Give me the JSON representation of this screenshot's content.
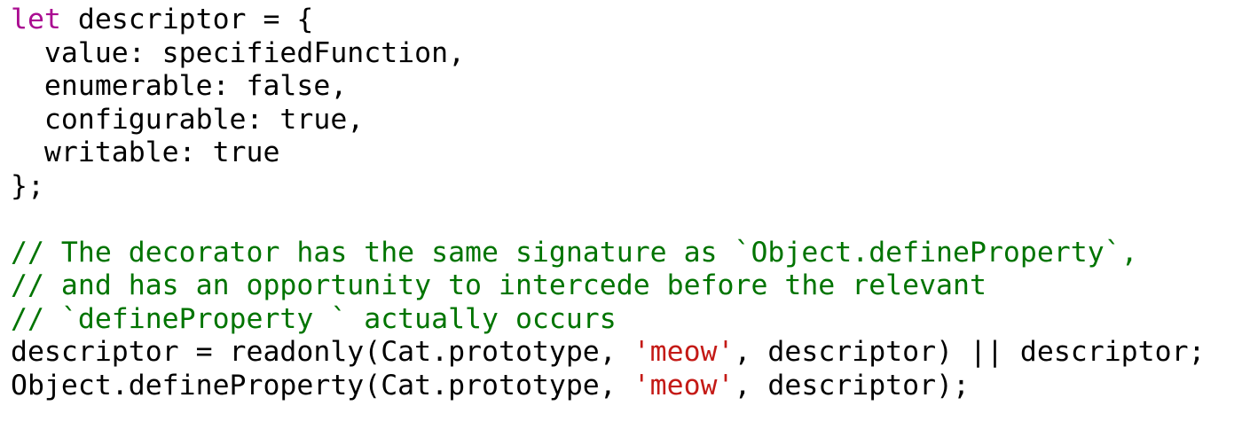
{
  "colors": {
    "keyword": "#aa0d91",
    "comment": "#007400",
    "string": "#c41a16",
    "plain": "#000000",
    "background": "#ffffff"
  },
  "code": {
    "lines": [
      {
        "keyword": "let",
        "rest": " descriptor = {"
      },
      {
        "text": "  value: specifiedFunction,"
      },
      {
        "text": "  enumerable: false,"
      },
      {
        "text": "  configurable: true,"
      },
      {
        "text": "  writable: true"
      },
      {
        "text": "};"
      },
      {
        "text": ""
      },
      {
        "comment": "// The decorator has the same signature as `Object.defineProperty`,"
      },
      {
        "comment": "// and has an opportunity to intercede before the relevant"
      },
      {
        "comment": "// `defineProperty ` actually occurs"
      },
      {
        "before": "descriptor = readonly(Cat.prototype, ",
        "string": "'meow'",
        "after": ", descriptor) || descriptor;"
      },
      {
        "before": "Object.defineProperty(Cat.prototype, ",
        "string": "'meow'",
        "after": ", descriptor);"
      }
    ]
  }
}
